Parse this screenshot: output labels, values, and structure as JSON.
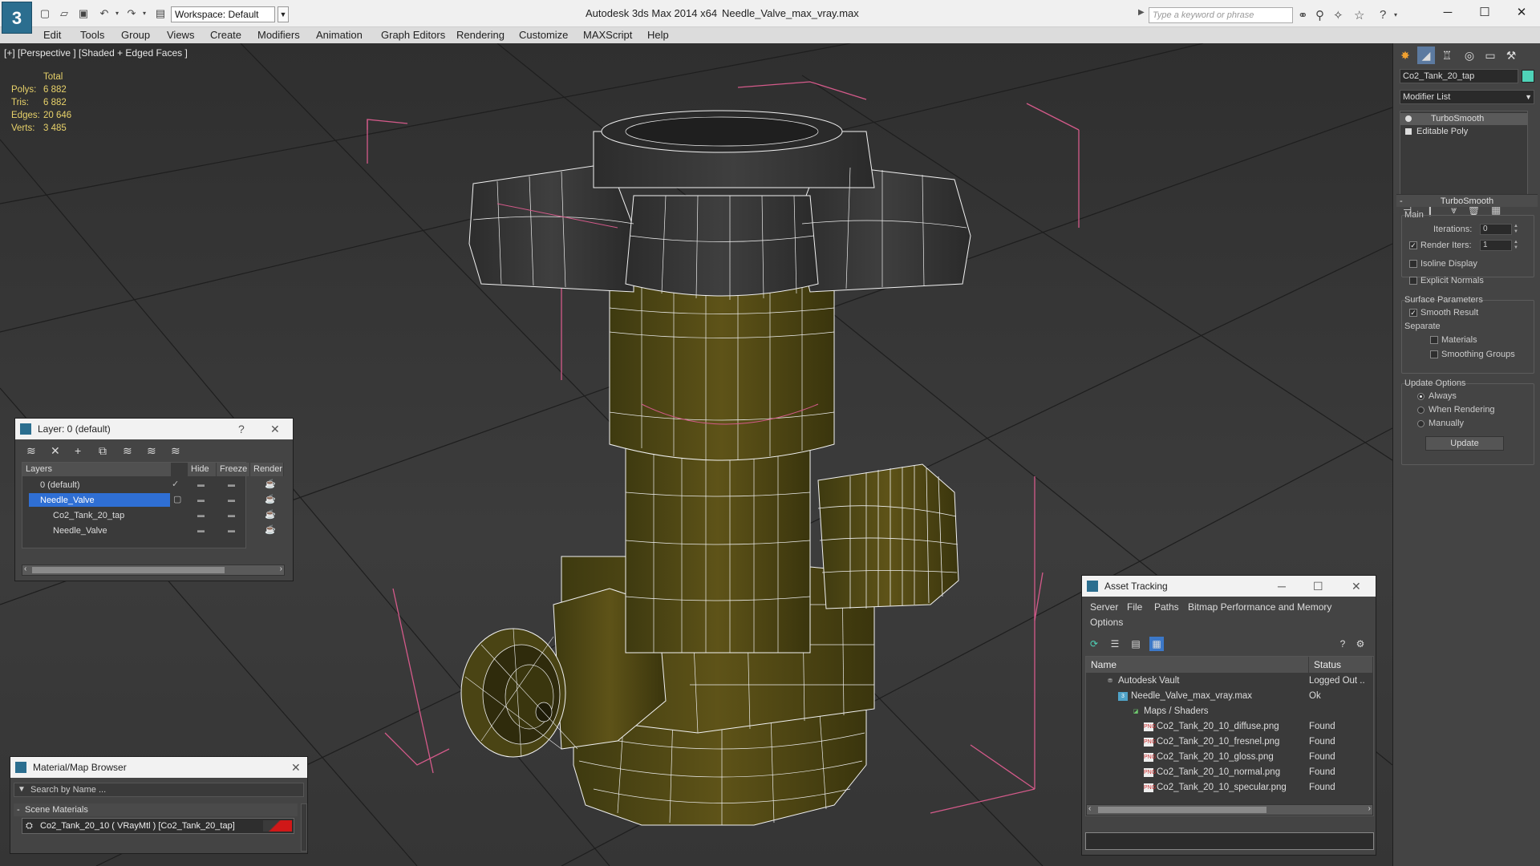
{
  "titlebar": {
    "app_title": "Autodesk 3ds Max  2014 x64",
    "document": "Needle_Valve_max_vray.max",
    "workspace": "Workspace: Default",
    "search_placeholder": "Type a keyword or phrase",
    "minimize": "─",
    "maximize": "☐",
    "close": "✕"
  },
  "menu": [
    "Edit",
    "Tools",
    "Group",
    "Views",
    "Create",
    "Modifiers",
    "Animation",
    "Graph Editors",
    "Rendering",
    "Customize",
    "MAXScript",
    "Help"
  ],
  "viewport": {
    "label": "[+] [Perspective ] [Shaded + Edged Faces ]",
    "stats": {
      "header": "Total",
      "rows": [
        {
          "key": "Polys:",
          "value": "6 882"
        },
        {
          "key": "Tris:",
          "value": "6 882"
        },
        {
          "key": "Edges:",
          "value": "20 646"
        },
        {
          "key": "Verts:",
          "value": "3 485"
        }
      ]
    }
  },
  "command_panel": {
    "object_name": "Co2_Tank_20_tap",
    "object_color": "#4fd3b8",
    "modifier_list": "Modifier List",
    "stack": [
      "TurboSmooth",
      "Editable Poly"
    ],
    "rollout_title": "TurboSmooth",
    "main_group": "Main",
    "iterations_label": "Iterations:",
    "iterations_value": "0",
    "render_iters_label": "Render Iters:",
    "render_iters_value": "1",
    "isoline_label": "Isoline Display",
    "explicit_normals_label": "Explicit Normals",
    "surface_group": "Surface Parameters",
    "smooth_result_label": "Smooth Result",
    "separate_label": "Separate",
    "materials_label": "Materials",
    "smoothing_groups_label": "Smoothing Groups",
    "update_group": "Update Options",
    "always_label": "Always",
    "when_rendering_label": "When Rendering",
    "manually_label": "Manually",
    "update_button": "Update"
  },
  "layer_dialog": {
    "title": "Layer: 0 (default)",
    "help": "?",
    "close": "✕",
    "columns": [
      "Layers",
      "Hide",
      "Freeze",
      "Render"
    ],
    "rows": [
      {
        "name": "0 (default)",
        "indent": 0
      },
      {
        "name": "Needle_Valve",
        "indent": 0,
        "selected": true
      },
      {
        "name": "Co2_Tank_20_tap",
        "indent": 1
      },
      {
        "name": "Needle_Valve",
        "indent": 1
      }
    ]
  },
  "asset_tracking": {
    "title": "Asset Tracking",
    "menu": [
      "Server",
      "File",
      "Paths",
      "Bitmap Performance and Memory",
      "Options"
    ],
    "columns": [
      "Name",
      "Status"
    ],
    "rows": [
      {
        "name": "Autodesk Vault",
        "status": "Logged Out ..",
        "indent": 1,
        "icon": "vault"
      },
      {
        "name": "Needle_Valve_max_vray.max",
        "status": "Ok",
        "indent": 2,
        "icon": "max"
      },
      {
        "name": "Maps / Shaders",
        "status": "",
        "indent": 3,
        "icon": "maps"
      },
      {
        "name": "Co2_Tank_20_10_diffuse.png",
        "status": "Found",
        "indent": 4,
        "icon": "png"
      },
      {
        "name": "Co2_Tank_20_10_fresnel.png",
        "status": "Found",
        "indent": 4,
        "icon": "png"
      },
      {
        "name": "Co2_Tank_20_10_gloss.png",
        "status": "Found",
        "indent": 4,
        "icon": "png"
      },
      {
        "name": "Co2_Tank_20_10_normal.png",
        "status": "Found",
        "indent": 4,
        "icon": "png"
      },
      {
        "name": "Co2_Tank_20_10_specular.png",
        "status": "Found",
        "indent": 4,
        "icon": "png"
      }
    ]
  },
  "material_browser": {
    "title": "Material/Map Browser",
    "search_placeholder": "Search by Name ...",
    "group": "Scene Materials",
    "item": "Co2_Tank_20_10  ( VRayMtl )  [Co2_Tank_20_tap]"
  }
}
